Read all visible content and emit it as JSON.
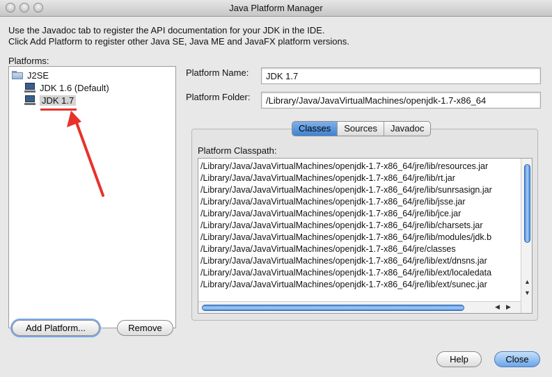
{
  "window": {
    "title": "Java Platform Manager"
  },
  "intro": {
    "line1": "Use the Javadoc tab to register the API documentation for your JDK in the IDE.",
    "line2": "Click Add Platform to register other Java SE, Java ME and JavaFX platform versions."
  },
  "platforms": {
    "label": "Platforms:",
    "category": "J2SE",
    "items": [
      {
        "label": "JDK 1.6 (Default)",
        "selected": false
      },
      {
        "label": "JDK 1.7",
        "selected": true
      }
    ]
  },
  "details": {
    "name_label": "Platform Name:",
    "name_value": "JDK 1.7",
    "folder_label": "Platform Folder:",
    "folder_value": "/Library/Java/JavaVirtualMachines/openjdk-1.7-x86_64"
  },
  "tabs": [
    {
      "label": "Classes",
      "active": true
    },
    {
      "label": "Sources",
      "active": false
    },
    {
      "label": "Javadoc",
      "active": false
    }
  ],
  "classpath": {
    "label": "Platform Classpath:",
    "entries": [
      "/Library/Java/JavaVirtualMachines/openjdk-1.7-x86_64/jre/lib/resources.jar",
      "/Library/Java/JavaVirtualMachines/openjdk-1.7-x86_64/jre/lib/rt.jar",
      "/Library/Java/JavaVirtualMachines/openjdk-1.7-x86_64/jre/lib/sunrsasign.jar",
      "/Library/Java/JavaVirtualMachines/openjdk-1.7-x86_64/jre/lib/jsse.jar",
      "/Library/Java/JavaVirtualMachines/openjdk-1.7-x86_64/jre/lib/jce.jar",
      "/Library/Java/JavaVirtualMachines/openjdk-1.7-x86_64/jre/lib/charsets.jar",
      "/Library/Java/JavaVirtualMachines/openjdk-1.7-x86_64/jre/lib/modules/jdk.b",
      "/Library/Java/JavaVirtualMachines/openjdk-1.7-x86_64/jre/classes",
      "/Library/Java/JavaVirtualMachines/openjdk-1.7-x86_64/jre/lib/ext/dnsns.jar",
      "/Library/Java/JavaVirtualMachines/openjdk-1.7-x86_64/jre/lib/ext/localedata",
      "/Library/Java/JavaVirtualMachines/openjdk-1.7-x86_64/jre/lib/ext/sunec.jar"
    ]
  },
  "buttons": {
    "add_platform": "Add Platform...",
    "remove": "Remove",
    "help": "Help",
    "close": "Close"
  },
  "colors": {
    "annotation_red": "#e8312a",
    "selection_blue": "#3e82d4"
  }
}
